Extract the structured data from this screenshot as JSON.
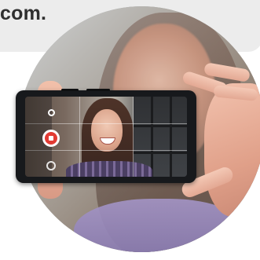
{
  "banner": {
    "text": "com."
  },
  "colors": {
    "banner_bg": "#ececec",
    "banner_text": "#2f2f2f",
    "record_red": "#e23b33",
    "phone_body": "#17191c"
  },
  "icons": {
    "mode": "circle-outline-icon",
    "record": "record-stop-icon",
    "flip": "camera-flip-icon"
  }
}
